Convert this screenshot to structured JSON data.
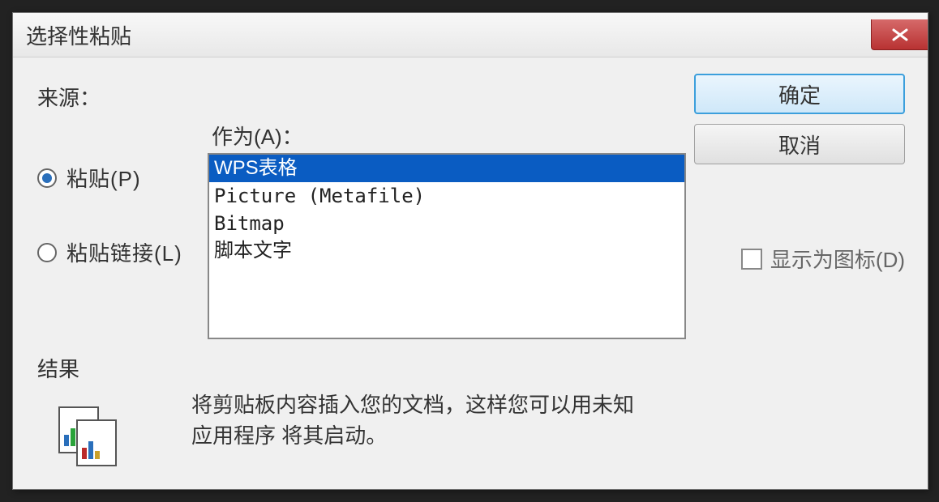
{
  "dialog": {
    "title": "选择性粘贴",
    "source_label": "来源：",
    "as_label": "作为(A)：",
    "paste_radio": "粘贴(P)",
    "paste_link_radio": "粘贴链接(L)",
    "selected_radio": "paste",
    "list_items": [
      {
        "label": "WPS表格",
        "selected": true,
        "cjk": true
      },
      {
        "label": "Picture (Metafile)",
        "selected": false,
        "cjk": false
      },
      {
        "label": "Bitmap",
        "selected": false,
        "cjk": false
      },
      {
        "label": "脚本文字",
        "selected": false,
        "cjk": true
      }
    ],
    "ok_label": "确定",
    "cancel_label": "取消",
    "show_as_icon_label": "显示为图标(D)",
    "show_as_icon_checked": false,
    "result_label": "结果",
    "result_description": "将剪贴板内容插入您的文档，这样您可以用未知应用程序 将其启动。"
  }
}
